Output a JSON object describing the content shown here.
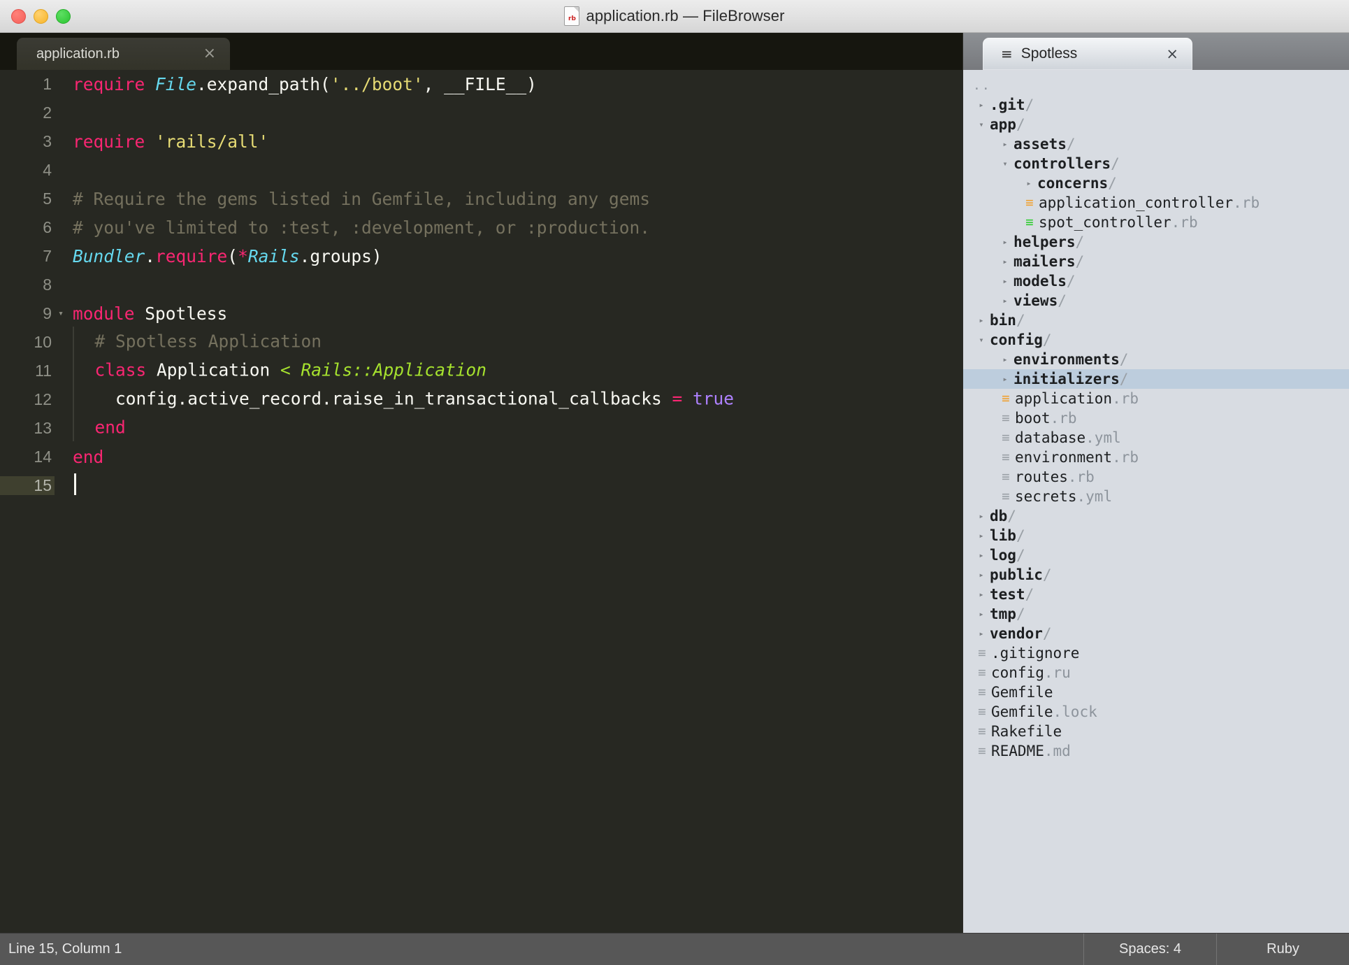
{
  "window": {
    "title": "application.rb — FileBrowser",
    "file_icon": "ruby-file-icon",
    "buttons": {
      "close": "close",
      "minimize": "minimize",
      "maximize": "maximize"
    }
  },
  "editor": {
    "tab": {
      "label": "application.rb",
      "close": "×"
    },
    "lines": [
      {
        "n": "1",
        "fold": "",
        "indent": 0,
        "tokens": [
          {
            "t": "key",
            "v": "require"
          },
          {
            "t": "plain",
            "v": " "
          },
          {
            "t": "const",
            "v": "File"
          },
          {
            "t": "plain",
            "v": ".expand_path("
          },
          {
            "t": "str",
            "v": "'../boot'"
          },
          {
            "t": "plain",
            "v": ", __FILE__)"
          }
        ]
      },
      {
        "n": "2",
        "fold": "",
        "indent": 0,
        "tokens": []
      },
      {
        "n": "3",
        "fold": "",
        "indent": 0,
        "tokens": [
          {
            "t": "key",
            "v": "require"
          },
          {
            "t": "plain",
            "v": " "
          },
          {
            "t": "str",
            "v": "'rails/all'"
          }
        ]
      },
      {
        "n": "4",
        "fold": "",
        "indent": 0,
        "tokens": []
      },
      {
        "n": "5",
        "fold": "",
        "indent": 0,
        "tokens": [
          {
            "t": "com",
            "v": "# Require the gems listed in Gemfile, including any gems"
          }
        ]
      },
      {
        "n": "6",
        "fold": "",
        "indent": 0,
        "tokens": [
          {
            "t": "com",
            "v": "# you've limited to :test, :development, or :production."
          }
        ]
      },
      {
        "n": "7",
        "fold": "",
        "indent": 0,
        "tokens": [
          {
            "t": "const",
            "v": "Bundler"
          },
          {
            "t": "plain",
            "v": "."
          },
          {
            "t": "key",
            "v": "require"
          },
          {
            "t": "plain",
            "v": "("
          },
          {
            "t": "op",
            "v": "*"
          },
          {
            "t": "const",
            "v": "Rails"
          },
          {
            "t": "plain",
            "v": ".groups)"
          }
        ]
      },
      {
        "n": "8",
        "fold": "",
        "indent": 0,
        "tokens": []
      },
      {
        "n": "9",
        "fold": "▾",
        "indent": 0,
        "tokens": [
          {
            "t": "key",
            "v": "module"
          },
          {
            "t": "plain",
            "v": " Spotless"
          }
        ]
      },
      {
        "n": "10",
        "fold": "",
        "indent": 1,
        "tokens": [
          {
            "t": "com",
            "v": "  # Spotless Application"
          }
        ]
      },
      {
        "n": "11",
        "fold": "",
        "indent": 1,
        "tokens": [
          {
            "t": "plain",
            "v": "  "
          },
          {
            "t": "key",
            "v": "class"
          },
          {
            "t": "plain",
            "v": " Application "
          },
          {
            "t": "class",
            "v": "< Rails::Application"
          }
        ]
      },
      {
        "n": "12",
        "fold": "",
        "indent": 1,
        "tokens": [
          {
            "t": "plain",
            "v": "    config.active_record.raise_in_transactional_callbacks "
          },
          {
            "t": "op",
            "v": "="
          },
          {
            "t": "plain",
            "v": " "
          },
          {
            "t": "num",
            "v": "true"
          }
        ]
      },
      {
        "n": "13",
        "fold": "",
        "indent": 1,
        "tokens": [
          {
            "t": "plain",
            "v": "  "
          },
          {
            "t": "key",
            "v": "end"
          }
        ]
      },
      {
        "n": "14",
        "fold": "",
        "indent": 0,
        "tokens": [
          {
            "t": "key",
            "v": "end"
          }
        ]
      },
      {
        "n": "15",
        "fold": "",
        "indent": 0,
        "active": true,
        "cursor": true,
        "tokens": []
      }
    ]
  },
  "sidebar": {
    "tab": {
      "icon": "≡",
      "label": "Spotless",
      "close": "×"
    },
    "tree": [
      {
        "kind": "dots",
        "depth": 0,
        "name": ".."
      },
      {
        "kind": "dir",
        "depth": 0,
        "tw": "▸",
        "name": ".git",
        "slash": "/"
      },
      {
        "kind": "dir",
        "depth": 0,
        "tw": "▾",
        "name": "app",
        "slash": "/"
      },
      {
        "kind": "dir",
        "depth": 1,
        "tw": "▸",
        "name": "assets",
        "slash": "/"
      },
      {
        "kind": "dir",
        "depth": 1,
        "tw": "▾",
        "name": "controllers",
        "slash": "/"
      },
      {
        "kind": "dir",
        "depth": 2,
        "tw": "▸",
        "name": "concerns",
        "slash": "/"
      },
      {
        "kind": "file",
        "depth": 2,
        "icon": "≡",
        "status": "orange",
        "name": "application_controller",
        "ext": ".rb"
      },
      {
        "kind": "file",
        "depth": 2,
        "icon": "≡",
        "status": "green",
        "name": "spot_controller",
        "ext": ".rb"
      },
      {
        "kind": "dir",
        "depth": 1,
        "tw": "▸",
        "name": "helpers",
        "slash": "/"
      },
      {
        "kind": "dir",
        "depth": 1,
        "tw": "▸",
        "name": "mailers",
        "slash": "/"
      },
      {
        "kind": "dir",
        "depth": 1,
        "tw": "▸",
        "name": "models",
        "slash": "/"
      },
      {
        "kind": "dir",
        "depth": 1,
        "tw": "▸",
        "name": "views",
        "slash": "/"
      },
      {
        "kind": "dir",
        "depth": 0,
        "tw": "▸",
        "name": "bin",
        "slash": "/"
      },
      {
        "kind": "dir",
        "depth": 0,
        "tw": "▾",
        "name": "config",
        "slash": "/"
      },
      {
        "kind": "dir",
        "depth": 1,
        "tw": "▸",
        "name": "environments",
        "slash": "/"
      },
      {
        "kind": "dir",
        "depth": 1,
        "tw": "▸",
        "name": "initializers",
        "slash": "/",
        "selected": true
      },
      {
        "kind": "file",
        "depth": 1,
        "icon": "≡",
        "status": "orange",
        "name": "application",
        "ext": ".rb"
      },
      {
        "kind": "file",
        "depth": 1,
        "icon": "≡",
        "status": "gray",
        "name": "boot",
        "ext": ".rb"
      },
      {
        "kind": "file",
        "depth": 1,
        "icon": "≡",
        "status": "gray",
        "name": "database",
        "ext": ".yml"
      },
      {
        "kind": "file",
        "depth": 1,
        "icon": "≡",
        "status": "gray",
        "name": "environment",
        "ext": ".rb"
      },
      {
        "kind": "file",
        "depth": 1,
        "icon": "≡",
        "status": "gray",
        "name": "routes",
        "ext": ".rb"
      },
      {
        "kind": "file",
        "depth": 1,
        "icon": "≡",
        "status": "gray",
        "name": "secrets",
        "ext": ".yml"
      },
      {
        "kind": "dir",
        "depth": 0,
        "tw": "▸",
        "name": "db",
        "slash": "/"
      },
      {
        "kind": "dir",
        "depth": 0,
        "tw": "▸",
        "name": "lib",
        "slash": "/"
      },
      {
        "kind": "dir",
        "depth": 0,
        "tw": "▸",
        "name": "log",
        "slash": "/"
      },
      {
        "kind": "dir",
        "depth": 0,
        "tw": "▸",
        "name": "public",
        "slash": "/"
      },
      {
        "kind": "dir",
        "depth": 0,
        "tw": "▸",
        "name": "test",
        "slash": "/"
      },
      {
        "kind": "dir",
        "depth": 0,
        "tw": "▸",
        "name": "tmp",
        "slash": "/"
      },
      {
        "kind": "dir",
        "depth": 0,
        "tw": "▸",
        "name": "vendor",
        "slash": "/"
      },
      {
        "kind": "file",
        "depth": 0,
        "icon": "≡",
        "status": "gray",
        "name": ".gitignore",
        "ext": ""
      },
      {
        "kind": "file",
        "depth": 0,
        "icon": "≡",
        "status": "gray",
        "name": "config",
        "ext": ".ru"
      },
      {
        "kind": "file",
        "depth": 0,
        "icon": "≡",
        "status": "gray",
        "name": "Gemfile",
        "ext": ""
      },
      {
        "kind": "file",
        "depth": 0,
        "icon": "≡",
        "status": "gray",
        "name": "Gemfile",
        "ext": ".lock"
      },
      {
        "kind": "file",
        "depth": 0,
        "icon": "≡",
        "status": "gray",
        "name": "Rakefile",
        "ext": ""
      },
      {
        "kind": "file",
        "depth": 0,
        "icon": "≡",
        "status": "gray",
        "name": "README",
        "ext": ".md"
      }
    ]
  },
  "statusbar": {
    "position": "Line 15, Column 1",
    "indent": "Spaces: 4",
    "language": "Ruby"
  }
}
